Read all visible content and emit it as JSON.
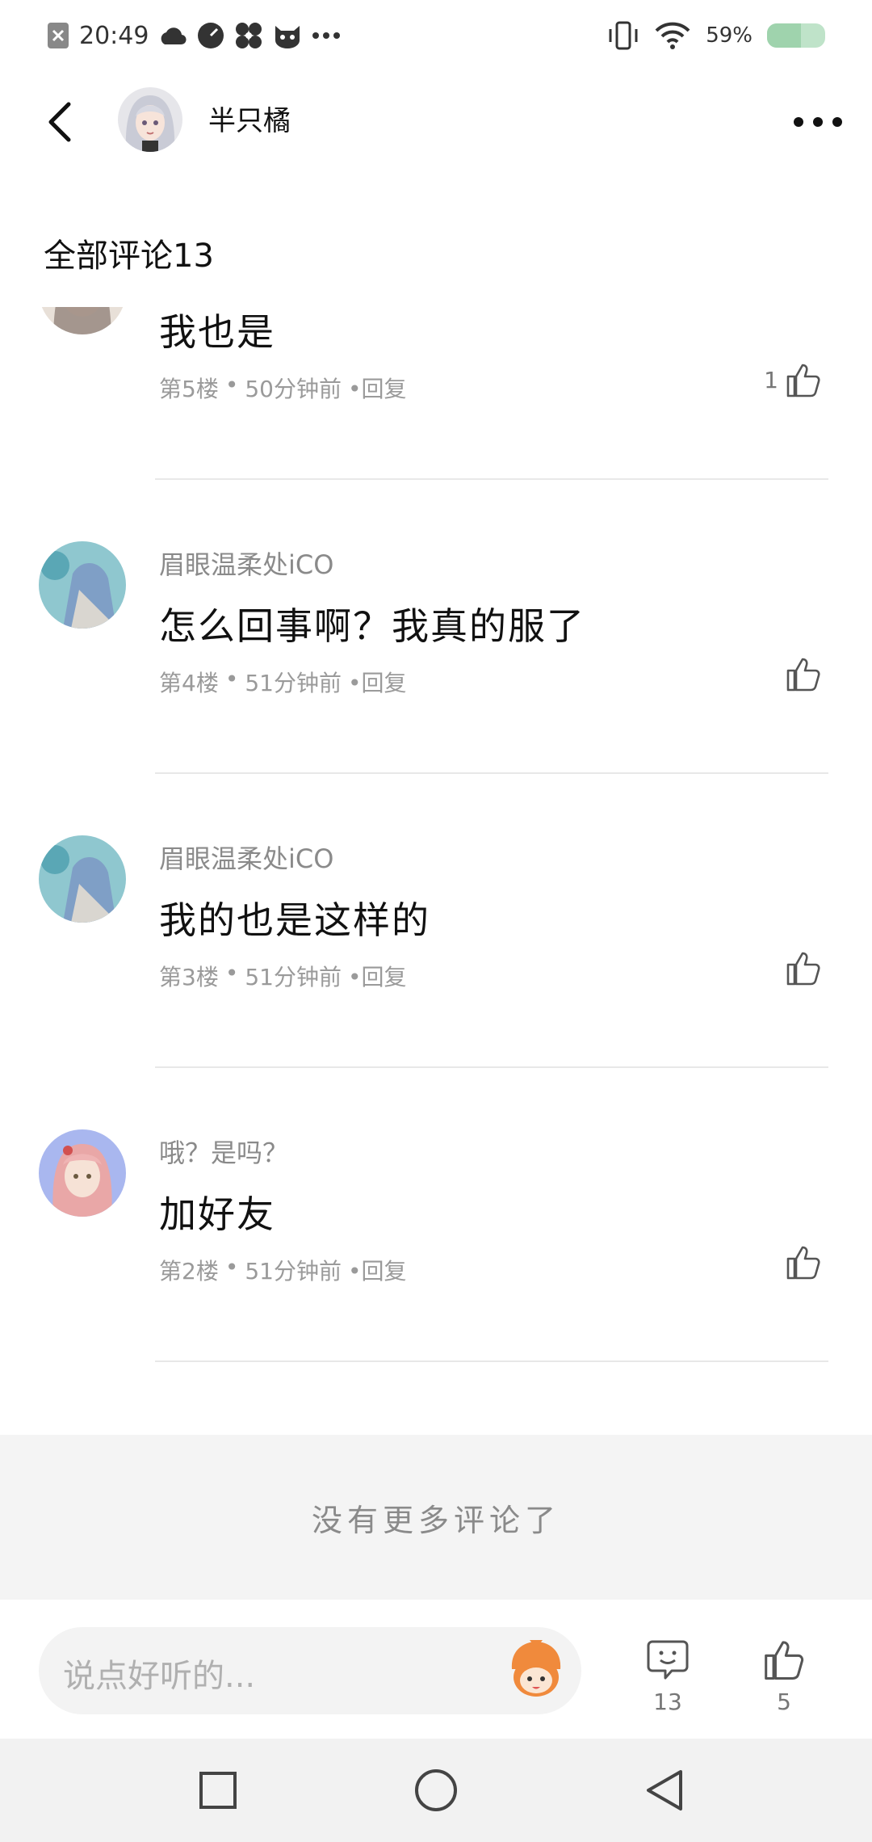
{
  "status_bar": {
    "time": "20:49",
    "battery_text": "59%",
    "battery_level": 0.59,
    "icons": [
      "notification-x-icon",
      "cloud-icon",
      "speed-icon",
      "fan-icon",
      "cat-icon",
      "more-dots-icon",
      "vibrate-icon",
      "wifi-icon",
      "battery-icon"
    ]
  },
  "header": {
    "author_name": "半只橘",
    "back_icon": "chevron-left-icon",
    "more_icon": "more-horizontal-icon"
  },
  "section_title": "全部评论13",
  "comments": [
    {
      "username": "",
      "text": "我也是",
      "floor": "第5楼",
      "time": "50分钟前",
      "reply": "•回复",
      "likes": "1"
    },
    {
      "username": "眉眼温柔处iCO",
      "text": "怎么回事啊？我真的服了",
      "floor": "第4楼",
      "time": "51分钟前",
      "reply": "•回复",
      "likes": ""
    },
    {
      "username": "眉眼温柔处iCO",
      "text": "我的也是这样的",
      "floor": "第3楼",
      "time": "51分钟前",
      "reply": "•回复",
      "likes": ""
    },
    {
      "username": "哦？是吗？",
      "text": "加好友",
      "floor": "第2楼",
      "time": "51分钟前",
      "reply": "•回复",
      "likes": ""
    }
  ],
  "footer_note": "没有更多评论了",
  "bottom_bar": {
    "input_placeholder": "说点好听的...",
    "comment_count": "13",
    "like_count": "5"
  },
  "colors": {
    "accent_orange": "#f08a3c",
    "divider": "#e8e8e8",
    "muted_text": "#9a9a9a"
  }
}
